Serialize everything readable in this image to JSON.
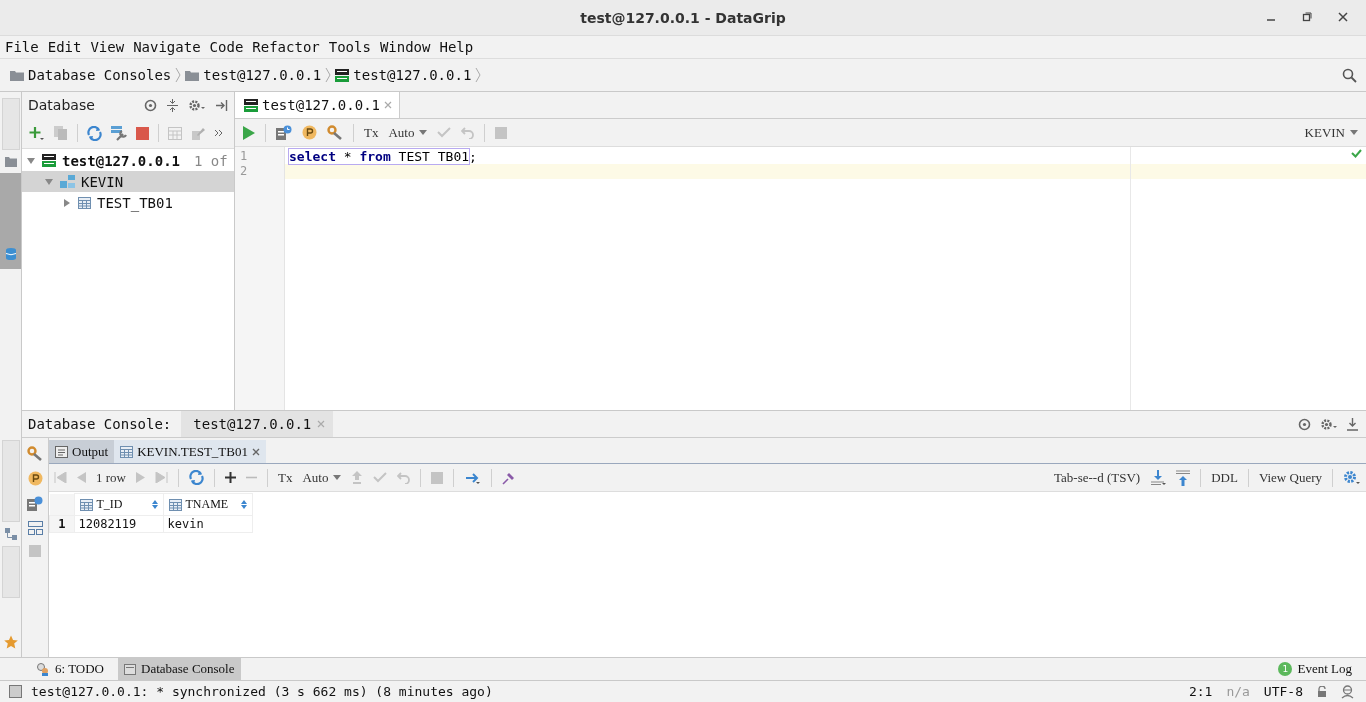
{
  "window": {
    "title": "test@127.0.0.1 - DataGrip"
  },
  "menu": [
    "File",
    "Edit",
    "View",
    "Navigate",
    "Code",
    "Refactor",
    "Tools",
    "Window",
    "Help"
  ],
  "breadcrumbs": [
    {
      "label": "Database Consoles",
      "kind": "folder"
    },
    {
      "label": "test@127.0.0.1",
      "kind": "folder"
    },
    {
      "label": "test@127.0.0.1",
      "kind": "db"
    }
  ],
  "database_panel": {
    "title": "Database",
    "tree": [
      {
        "label": "test@127.0.0.1",
        "kind": "datasource",
        "note": "1 of",
        "expanded": true,
        "selected": false,
        "children": [
          {
            "label": "KEVIN",
            "kind": "schema",
            "expanded": true,
            "selected": true,
            "children": [
              {
                "label": "TEST_TB01",
                "kind": "table",
                "expanded": false,
                "selected": false
              }
            ]
          }
        ]
      }
    ]
  },
  "editor": {
    "tabs": [
      {
        "label": "test@127.0.0.1",
        "selected": true
      }
    ],
    "tx": "Tx",
    "tx_mode": "Auto",
    "schema": "KEVIN",
    "lines": [
      {
        "number": "1",
        "current": false,
        "statement": [
          {
            "text": "select",
            "kind": "keyword"
          },
          {
            "text": " * ",
            "kind": "plain"
          },
          {
            "text": "from",
            "kind": "keyword"
          },
          {
            "text": " TEST TB01",
            "kind": "plain"
          }
        ],
        "rest": ";"
      },
      {
        "number": "2",
        "current": true
      }
    ]
  },
  "console": {
    "title": "Database Console:",
    "tabs": [
      {
        "label": "test@127.0.0.1",
        "selected": true
      }
    ],
    "result_tabs": [
      {
        "label": "Output",
        "kind": "output",
        "selected": false
      },
      {
        "label": "KEVIN.TEST_TB01",
        "kind": "table",
        "selected": true
      }
    ],
    "row_count": "1 row",
    "tx": "Tx",
    "tx_mode": "Auto",
    "export_format": "Tab-se--d (TSV)",
    "actions": [
      "DDL",
      "View Query"
    ],
    "columns": [
      "T_ID",
      "TNAME"
    ],
    "rows": [
      {
        "number": "1",
        "cells": [
          "12082119",
          "kevin"
        ]
      }
    ]
  },
  "tool_windows": [
    {
      "label": "6: TODO",
      "kind": "todo",
      "selected": false
    },
    {
      "label": "Database Console",
      "kind": "console",
      "selected": true
    }
  ],
  "event_log": {
    "label": "Event Log",
    "count": "1"
  },
  "status_bar": {
    "message": "test@127.0.0.1: * synchronized (3 s 662 ms) (8 minutes ago)",
    "position": "2:1",
    "context": "n/a",
    "encoding": "UTF-8"
  }
}
